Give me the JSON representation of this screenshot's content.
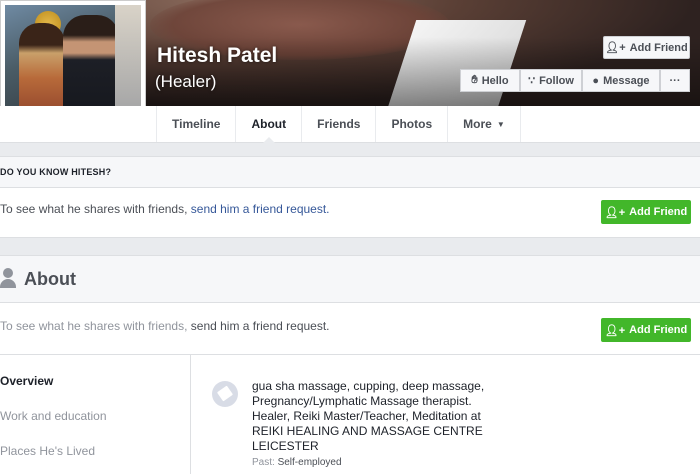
{
  "profile": {
    "name": "Hitesh Patel",
    "nickname": "(Healer)"
  },
  "header_actions": {
    "add_friend": "Add Friend",
    "hello": "Hello",
    "follow": "Follow",
    "message": "Message",
    "more": "···"
  },
  "tabs": [
    {
      "label": "Timeline"
    },
    {
      "label": "About"
    },
    {
      "label": "Friends"
    },
    {
      "label": "Photos"
    },
    {
      "label": "More"
    }
  ],
  "know": {
    "heading": "DO YOU KNOW HITESH?",
    "text": "To see what he shares with friends, ",
    "link": "send him a friend request.",
    "button": "Add Friend"
  },
  "about": {
    "heading": "About",
    "notice_text": "To see what he shares with friends, ",
    "notice_link": "send him a friend request.",
    "button": "Add Friend",
    "nav": [
      {
        "label": "Overview"
      },
      {
        "label": "Work and education"
      },
      {
        "label": "Places He's Lived"
      }
    ],
    "work": {
      "lines": [
        "gua sha massage, cupping, deep massage,",
        "Pregnancy/Lymphatic Massage therapist.",
        "Healer, Reiki Master/Teacher, Meditation at",
        "REIKI HEALING AND MASSAGE CENTRE",
        "LEICESTER"
      ],
      "past_label": "Past:",
      "past_value": "Self-employed"
    }
  },
  "colors": {
    "accent_green": "#42b72a",
    "link_blue": "#365899",
    "background": "#e9ebee"
  }
}
